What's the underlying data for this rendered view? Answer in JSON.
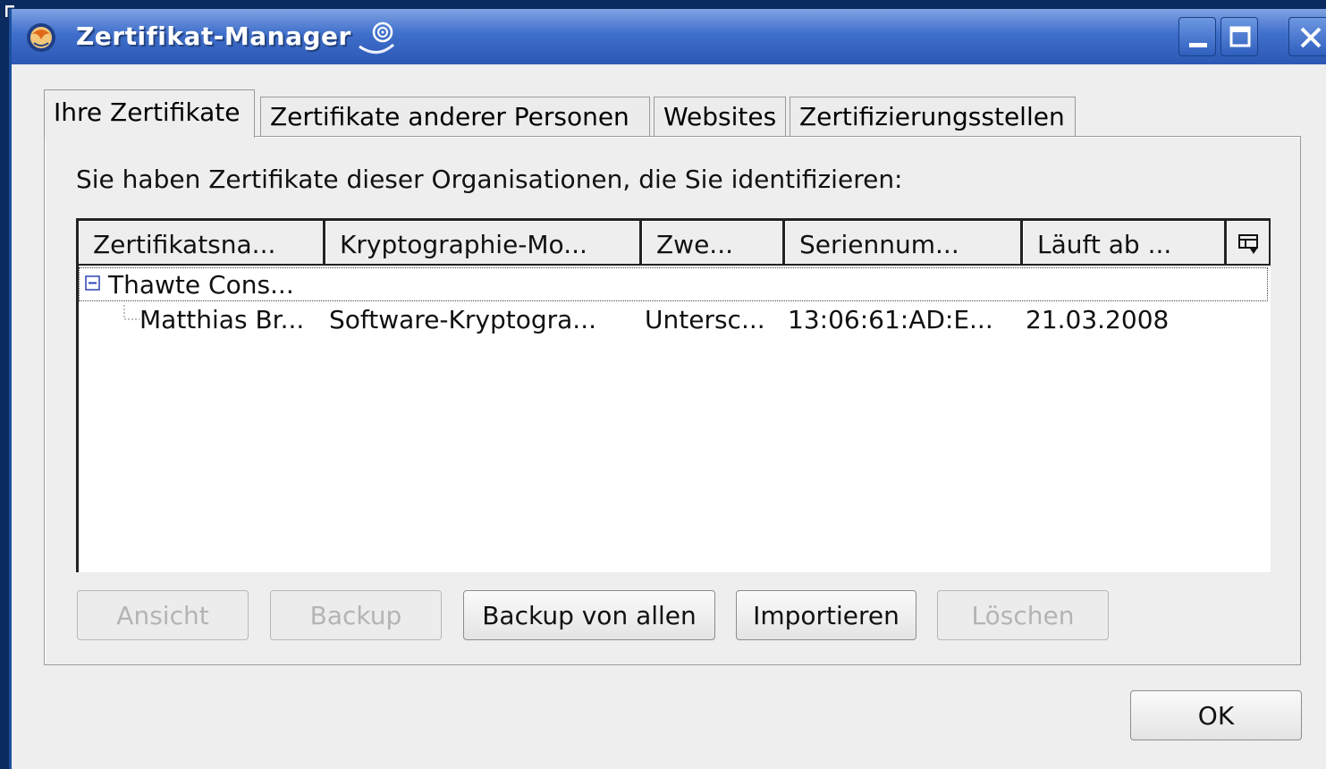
{
  "window": {
    "title": "Zertifikat-Manager",
    "controls": [
      "minimize-icon",
      "maximize-icon",
      "close-icon"
    ]
  },
  "tabs": [
    {
      "label": "Ihre Zertifikate",
      "active": true
    },
    {
      "label": "Zertifikate anderer Personen",
      "active": false
    },
    {
      "label": "Websites",
      "active": false
    },
    {
      "label": "Zertifizierungsstellen",
      "active": false
    }
  ],
  "intro_text": "Sie haben Zertifikate dieser Organisationen, die Sie identifizieren:",
  "table": {
    "columns": [
      "Zertifikatsna...",
      "Kryptographie-Mo...",
      "Zwe...",
      "Seriennum...",
      "Läuft ab ..."
    ],
    "column_picker_icon": "column-picker-icon",
    "groups": [
      {
        "name": "Thawte Cons...",
        "expanded": true,
        "rows": [
          [
            "Matthias Br...",
            "Software-Kryptogra...",
            "Untersc...",
            "13:06:61:AD:E...",
            "21.03.2008"
          ]
        ]
      }
    ]
  },
  "buttons": {
    "view": "Ansicht",
    "backup": "Backup",
    "backup_all": "Backup von allen",
    "import": "Importieren",
    "delete": "Löschen",
    "ok": "OK"
  },
  "colors": {
    "titlebar": "#3f6fcb",
    "desktop": "#0b2a5e",
    "dialog": "#eeeeee"
  }
}
